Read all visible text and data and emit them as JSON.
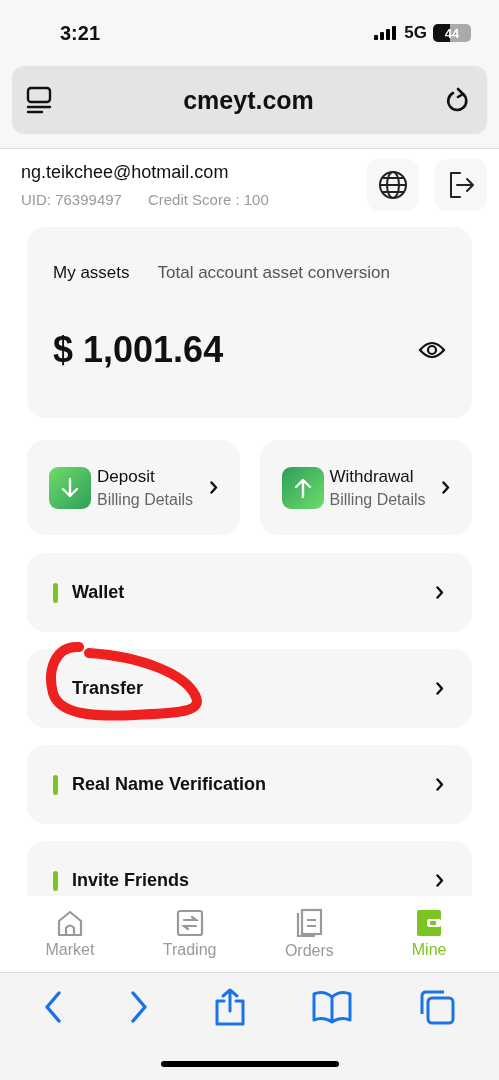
{
  "status_bar": {
    "time": "3:21",
    "network": "5G",
    "battery": "44"
  },
  "address_bar": {
    "url": "cmeyt.com"
  },
  "profile": {
    "email": "ng.teikchee@hotmail.com",
    "uid": "UID: 76399497",
    "credit_score": "Credit Score : 100"
  },
  "assets": {
    "title": "My assets",
    "subtitle": "Total account asset conversion",
    "amount": "$ 1,001.64"
  },
  "actions": [
    {
      "kind": "deposit",
      "title": "Deposit",
      "subtitle": "Billing Details"
    },
    {
      "kind": "withdrawal",
      "title": "Withdrawal",
      "subtitle": "Billing Details"
    }
  ],
  "menu": [
    {
      "label": "Wallet",
      "marker": true,
      "circled": false
    },
    {
      "label": "Transfer",
      "marker": false,
      "circled": true
    },
    {
      "label": "Real Name Verification",
      "marker": true,
      "circled": false
    },
    {
      "label": "Invite Friends",
      "marker": true,
      "circled": false
    }
  ],
  "tabs": [
    {
      "label": "Market",
      "kind": "home",
      "selected": false
    },
    {
      "label": "Trading",
      "kind": "trading",
      "selected": false
    },
    {
      "label": "Orders",
      "kind": "orders",
      "selected": false
    },
    {
      "label": "Mine",
      "kind": "wallet",
      "selected": true
    }
  ]
}
